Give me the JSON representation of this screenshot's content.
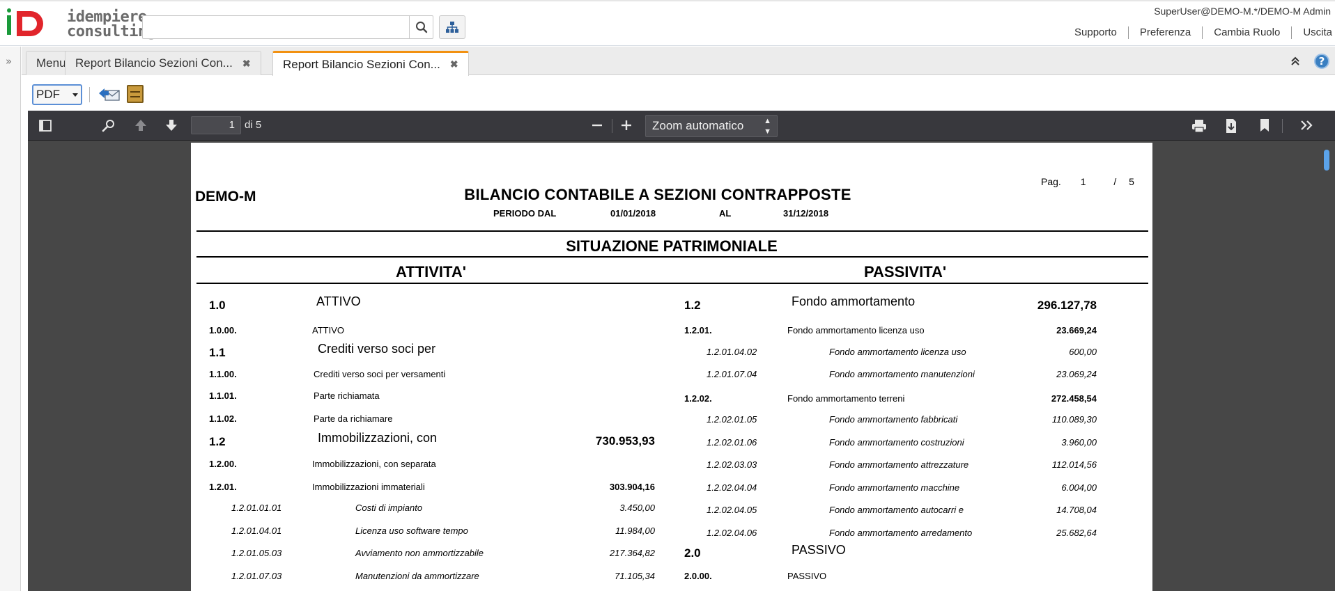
{
  "header": {
    "logo_line1": "idempiere",
    "logo_line2": "consulting",
    "search_placeholder": "",
    "user": "SuperUser@DEMO-M.*/DEMO-M Admin",
    "links": [
      "Supporto",
      "Preferenza",
      "Cambia Ruolo",
      "Uscita"
    ]
  },
  "tabs": [
    {
      "label": "Menu"
    },
    {
      "label": "Report Bilancio Sezioni Con..."
    },
    {
      "label": "Report Bilancio Sezioni Con..."
    }
  ],
  "toolbar": {
    "format": "PDF"
  },
  "viewer": {
    "page_current": "1",
    "page_total_label": "di 5",
    "zoom": "Zoom automatico"
  },
  "report": {
    "pag_label": "Pag.",
    "pag_current": "1",
    "pag_sep": "/",
    "pag_total": "5",
    "company": "DEMO-M",
    "title": "BILANCIO CONTABILE A SEZIONI CONTRAPPOSTE",
    "periodo_label": "PERIODO DAL",
    "date_from": "01/01/2018",
    "al_label": "AL",
    "date_to": "31/12/2018",
    "section": "SITUAZIONE PATRIMONIALE",
    "left_head": "ATTIVITA'",
    "right_head": "PASSIVITA'",
    "left_rows": [
      {
        "code": "1.0",
        "desc": "ATTIVO",
        "amount": "",
        "level": "group"
      },
      {
        "code": "1.0.00.",
        "desc": "ATTIVO",
        "amount": "",
        "level": "sub"
      },
      {
        "code": "1.1",
        "desc": "Crediti verso soci per",
        "amount": "",
        "level": "group"
      },
      {
        "code": "1.1.00.",
        "desc": "Crediti verso soci per versamenti",
        "amount": "",
        "level": "sub"
      },
      {
        "code": "1.1.01.",
        "desc": "Parte richiamata",
        "amount": "",
        "level": "sub"
      },
      {
        "code": "1.1.02.",
        "desc": "Parte da richiamare",
        "amount": "",
        "level": "sub"
      },
      {
        "code": "1.2",
        "desc": "Immobilizzazioni, con",
        "amount": "730.953,93",
        "level": "group"
      },
      {
        "code": "1.2.00.",
        "desc": "Immobilizzazioni, con separata",
        "amount": "",
        "level": "sub"
      },
      {
        "code": "1.2.01.",
        "desc": "Immobilizzazioni immateriali",
        "amount": "303.904,16",
        "level": "sub"
      },
      {
        "code": "1.2.01.01.01",
        "desc": "Costi di impianto",
        "amount": "3.450,00",
        "level": "acct"
      },
      {
        "code": "1.2.01.04.01",
        "desc": "Licenza uso software tempo",
        "amount": "11.984,00",
        "level": "acct"
      },
      {
        "code": "1.2.01.05.03",
        "desc": "Avviamento non ammortizzabile",
        "amount": "217.364,82",
        "level": "acct"
      },
      {
        "code": "1.2.01.07.03",
        "desc": "Manutenzioni da ammortizzare",
        "amount": "71.105,34",
        "level": "acct"
      }
    ],
    "right_rows": [
      {
        "code": "1.2",
        "desc": "Fondo ammortamento",
        "amount": "296.127,78",
        "level": "group"
      },
      {
        "code": "1.2.01.",
        "desc": "Fondo ammortamento licenza uso",
        "amount": "23.669,24",
        "level": "sub"
      },
      {
        "code": "1.2.01.04.02",
        "desc": "Fondo ammortamento licenza uso",
        "amount": "600,00",
        "level": "acct"
      },
      {
        "code": "1.2.01.07.04",
        "desc": "Fondo ammortamento manutenzioni",
        "amount": "23.069,24",
        "level": "acct"
      },
      {
        "code": "1.2.02.",
        "desc": "Fondo ammortamento terreni",
        "amount": "272.458,54",
        "level": "sub"
      },
      {
        "code": "1.2.02.01.05",
        "desc": "Fondo ammortamento fabbricati",
        "amount": "110.089,30",
        "level": "acct"
      },
      {
        "code": "1.2.02.01.06",
        "desc": "Fondo ammortamento costruzioni",
        "amount": "3.960,00",
        "level": "acct"
      },
      {
        "code": "1.2.02.03.03",
        "desc": "Fondo ammortamento attrezzature",
        "amount": "112.014,56",
        "level": "acct"
      },
      {
        "code": "1.2.02.04.04",
        "desc": "Fondo ammortamento macchine",
        "amount": "6.004,00",
        "level": "acct"
      },
      {
        "code": "1.2.02.04.05",
        "desc": "Fondo ammortamento autocarri e",
        "amount": "14.708,04",
        "level": "acct"
      },
      {
        "code": "1.2.02.04.06",
        "desc": "Fondo ammortamento arredamento",
        "amount": "25.682,64",
        "level": "acct"
      },
      {
        "code": "2.0",
        "desc": "PASSIVO",
        "amount": "",
        "level": "group"
      },
      {
        "code": "2.0.00.",
        "desc": "PASSIVO",
        "amount": "",
        "level": "sub"
      }
    ]
  }
}
